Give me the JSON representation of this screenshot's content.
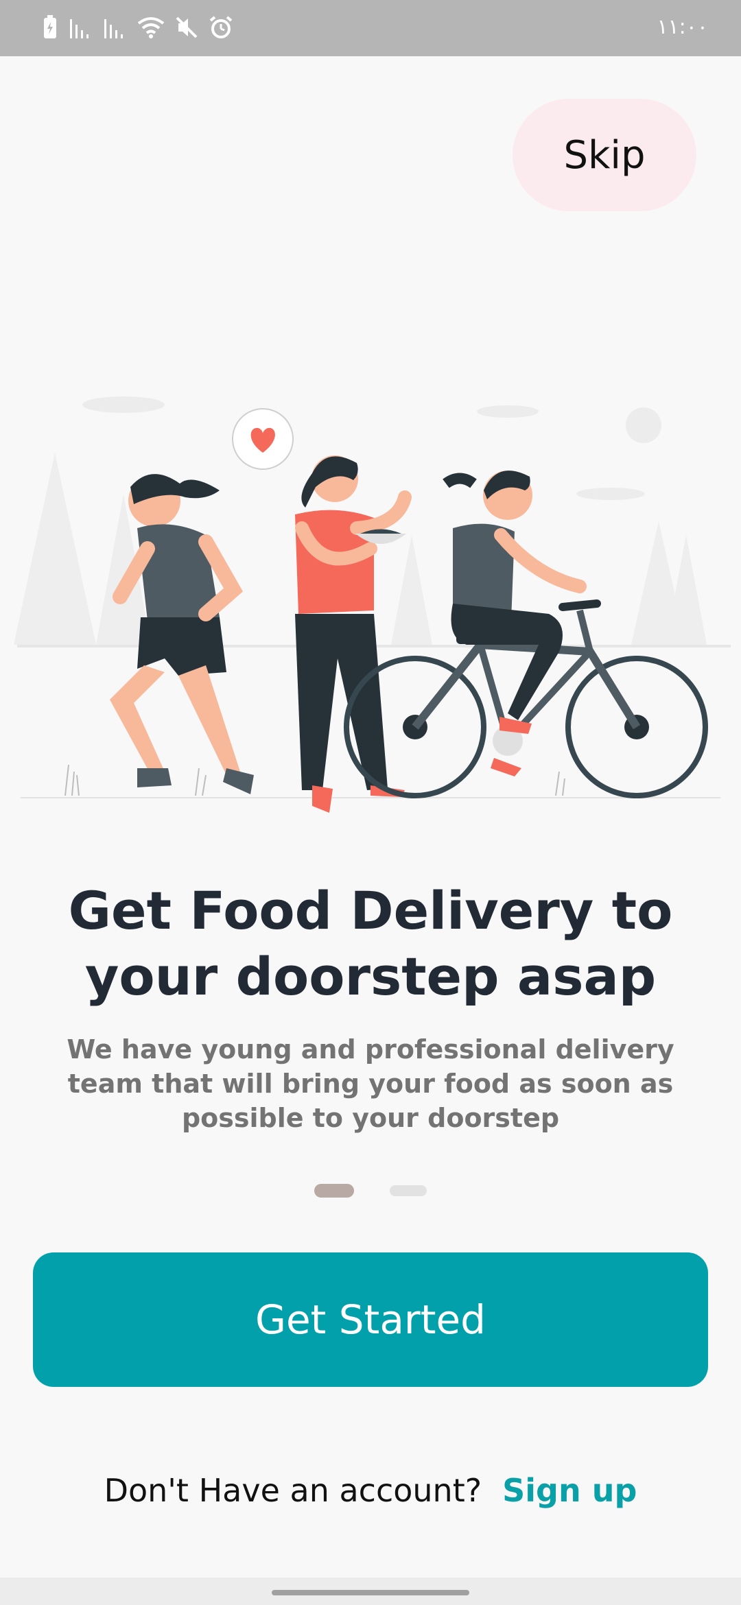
{
  "status_bar": {
    "time": "١١:٠٠",
    "icons": [
      "battery-charging-icon",
      "signal-icon",
      "signal-icon",
      "wifi-icon",
      "mute-icon",
      "alarm-icon"
    ]
  },
  "skip_label": "Skip",
  "headline": "Get Food Delivery to your doorstep asap",
  "description": "We have young and professional delivery team that will bring your food as soon as possible to your doorstep",
  "pager": {
    "count": 2,
    "active_index": 0
  },
  "cta_label": "Get Started",
  "account_prompt": "Don't Have an account?",
  "signup_label": "Sign up",
  "colors": {
    "accent": "#02a0ab",
    "skip_bg": "#fbebef",
    "headline": "#222a35",
    "body_text": "#737373"
  }
}
